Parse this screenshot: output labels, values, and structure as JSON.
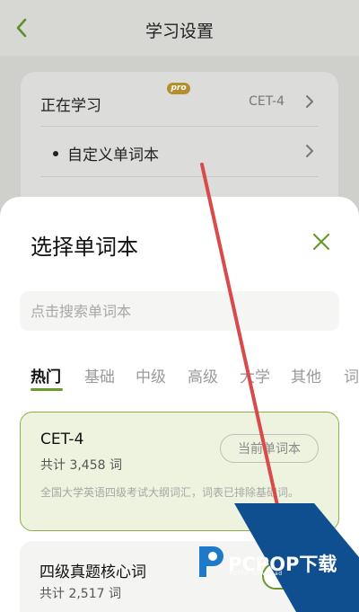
{
  "header": {
    "title": "学习设置",
    "back_icon": "chevron-left-icon",
    "accent_color": "#6a9a2a"
  },
  "settings": {
    "current_label": "正在学习",
    "current_value": "CET-4",
    "custom_label": "自定义单词本",
    "pro_badge": "pro"
  },
  "sheet": {
    "title": "选择单词本",
    "close_icon": "close-icon",
    "search_placeholder": "点击搜索单词本",
    "tabs": [
      {
        "label": "热门",
        "active": true
      },
      {
        "label": "基础",
        "active": false
      },
      {
        "label": "中级",
        "active": false
      },
      {
        "label": "高级",
        "active": false
      },
      {
        "label": "大学",
        "active": false
      },
      {
        "label": "其他",
        "active": false
      },
      {
        "label": "词",
        "active": false
      }
    ],
    "books": [
      {
        "name": "CET-4",
        "count": "共计 3,458 词",
        "desc": "全国大学英语四级考试大纲词汇，词表已排除基础词。",
        "button": "当前单词本",
        "selected": true
      },
      {
        "name": "四级真题核心词",
        "count": "共计 2,517 词",
        "button": "选择",
        "selected": false
      }
    ]
  },
  "watermark": {
    "brand": "PCPOP下载",
    "sub": "PCPOP Download"
  }
}
